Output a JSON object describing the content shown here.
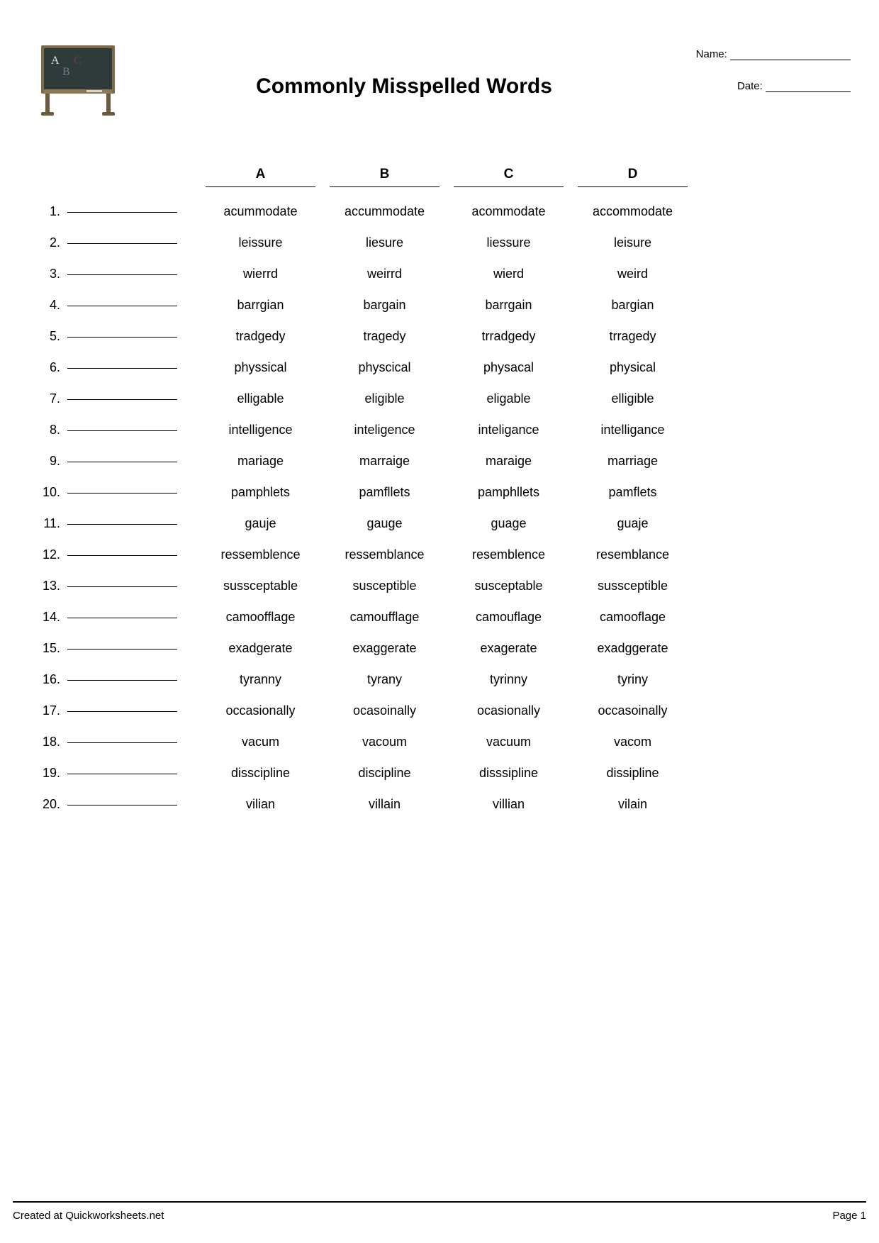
{
  "title": "Commonly Misspelled Words",
  "name_label": "Name:",
  "date_label": "Date:",
  "columns": [
    "A",
    "B",
    "C",
    "D"
  ],
  "rows": [
    {
      "n": "1.",
      "opts": [
        "acummodate",
        "accummodate",
        "acommodate",
        "accommodate"
      ]
    },
    {
      "n": "2.",
      "opts": [
        "leissure",
        "liesure",
        "liessure",
        "leisure"
      ]
    },
    {
      "n": "3.",
      "opts": [
        "wierrd",
        "weirrd",
        "wierd",
        "weird"
      ]
    },
    {
      "n": "4.",
      "opts": [
        "barrgian",
        "bargain",
        "barrgain",
        "bargian"
      ]
    },
    {
      "n": "5.",
      "opts": [
        "tradgedy",
        "tragedy",
        "trradgedy",
        "trragedy"
      ]
    },
    {
      "n": "6.",
      "opts": [
        "physsical",
        "physcical",
        "physacal",
        "physical"
      ]
    },
    {
      "n": "7.",
      "opts": [
        "elligable",
        "eligible",
        "eligable",
        "elligible"
      ]
    },
    {
      "n": "8.",
      "opts": [
        "intelligence",
        "inteligence",
        "inteligance",
        "intelligance"
      ]
    },
    {
      "n": "9.",
      "opts": [
        "mariage",
        "marraige",
        "maraige",
        "marriage"
      ]
    },
    {
      "n": "10.",
      "opts": [
        "pamphlets",
        "pamfllets",
        "pamphllets",
        "pamflets"
      ]
    },
    {
      "n": "11.",
      "opts": [
        "gauje",
        "gauge",
        "guage",
        "guaje"
      ]
    },
    {
      "n": "12.",
      "opts": [
        "ressemblence",
        "ressemblance",
        "resemblence",
        "resemblance"
      ]
    },
    {
      "n": "13.",
      "opts": [
        "sussceptable",
        "susceptible",
        "susceptable",
        "sussceptible"
      ]
    },
    {
      "n": "14.",
      "opts": [
        "camoofflage",
        "camoufflage",
        "camouflage",
        "camooflage"
      ]
    },
    {
      "n": "15.",
      "opts": [
        "exadgerate",
        "exaggerate",
        "exagerate",
        "exadggerate"
      ]
    },
    {
      "n": "16.",
      "opts": [
        "tyranny",
        "tyrany",
        "tyrinny",
        "tyriny"
      ]
    },
    {
      "n": "17.",
      "opts": [
        "occasionally",
        "ocasoinally",
        "ocasionally",
        "occasoinally"
      ]
    },
    {
      "n": "18.",
      "opts": [
        "vacum",
        "vacoum",
        "vacuum",
        "vacom"
      ]
    },
    {
      "n": "19.",
      "opts": [
        "disscipline",
        "discipline",
        "disssipline",
        "dissipline"
      ]
    },
    {
      "n": "20.",
      "opts": [
        "vilian",
        "villain",
        "villian",
        "vilain"
      ]
    }
  ],
  "footer_left": "Created at Quickworksheets.net",
  "footer_right": "Page 1"
}
